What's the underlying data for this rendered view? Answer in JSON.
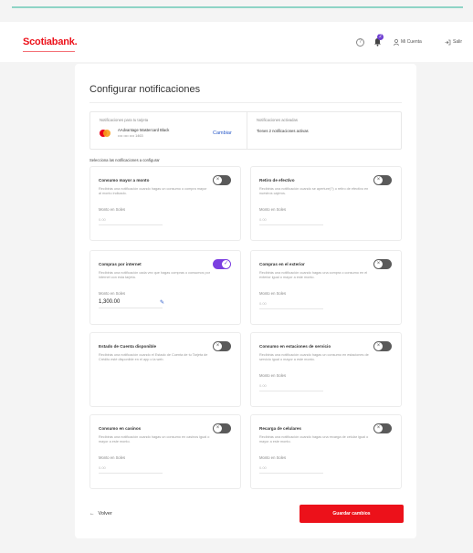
{
  "header": {
    "logo": "Scotiabank.",
    "help_icon": "?",
    "notification_count": "2",
    "account_label": "Mi Cuenta",
    "exit_label": "Salir"
  },
  "page": {
    "title": "Configurar notificaciones",
    "card_section_label": "Notificaciones para tu tarjeta",
    "card_name": "AAdvantage Mastercard Black",
    "card_number": "•••• •••• •••• 1463",
    "change_label": "Cambiar",
    "active_section_label": "Notificaciones activadas",
    "active_count": "Tienes 2 notificaciones activas",
    "select_label": "Selecciona las notificaciones a configurar"
  },
  "tiles": [
    {
      "title": "Consumo mayor a monto",
      "desc": "Recibirás una notificación cuando hagas un consumo o compra mayor al monto indicado.",
      "amount_label": "Monto en Soles",
      "amount": "0.00",
      "on": false
    },
    {
      "title": "Retiro de efectivo",
      "desc": "Recibirás una notificación cuando se aperture(?) o retiro de efectivo en nuestros cajeros.",
      "amount_label": "Monto en Soles",
      "amount": "0.00",
      "on": false
    },
    {
      "title": "Compras por internet",
      "desc": "Recibirás una notificación cada vez que hagas compras o consumos por internet con esta tarjeta.",
      "amount_label": "Monto en Soles",
      "amount": "1,300.00",
      "on": true
    },
    {
      "title": "Compras en el exterior",
      "desc": "Recibirás una notificación cuando hagas una compra o consumo en el exterior igual o mayor a este monto.",
      "amount_label": "Monto en Soles",
      "amount": "0.00",
      "on": false
    },
    {
      "title": "Estado de Cuenta disponible",
      "desc": "Recibirás una notificación cuando el Estado de Cuenta de tu Tarjeta de Crédito esté disponible en el app o la web.",
      "amount_label": "",
      "amount": "",
      "on": false
    },
    {
      "title": "Consumo en estaciones de servicio",
      "desc": "Recibirás una notificación cuando hagas un consumo en estaciones de servicio igual o mayor a este monto.",
      "amount_label": "Monto en Soles",
      "amount": "0.00",
      "on": false
    },
    {
      "title": "Consumo en casinos",
      "desc": "Recibirás una notificación cuando hagas un consumo en casinos igual o mayor a este monto.",
      "amount_label": "Monto en Soles",
      "amount": "0.00",
      "on": false
    },
    {
      "title": "Recarga de celulares",
      "desc": "Recibirás una notificación cuando hagas una recarga de celular igual o mayor a este monto.",
      "amount_label": "Monto en Soles",
      "amount": "0.00",
      "on": false
    }
  ],
  "footer": {
    "back_label": "Volver",
    "save_label": "Guardar cambios"
  },
  "colors": {
    "brand": "#ec111a",
    "toggle_on": "#7b3fe0",
    "link": "#2a5ac9"
  }
}
